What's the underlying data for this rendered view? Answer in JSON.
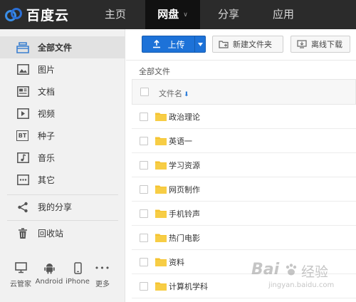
{
  "app": {
    "logo_text": "百度云"
  },
  "nav": [
    {
      "label": "主页"
    },
    {
      "label": "网盘",
      "caret": "∨"
    },
    {
      "label": "分享"
    },
    {
      "label": "应用"
    }
  ],
  "sidebar": {
    "items": [
      {
        "label": "全部文件",
        "icon": "all-files-icon"
      },
      {
        "label": "图片",
        "icon": "image-icon"
      },
      {
        "label": "文档",
        "icon": "document-icon"
      },
      {
        "label": "视频",
        "icon": "video-icon"
      },
      {
        "label": "种子",
        "icon": "torrent-icon",
        "icon_text": "BT"
      },
      {
        "label": "音乐",
        "icon": "music-icon"
      },
      {
        "label": "其它",
        "icon": "other-icon"
      },
      {
        "label": "我的分享",
        "icon": "share-icon"
      },
      {
        "label": "回收站",
        "icon": "trash-icon"
      }
    ],
    "devices": [
      {
        "label": "云管家",
        "icon": "desktop-icon"
      },
      {
        "label": "Android",
        "icon": "android-icon"
      },
      {
        "label": "iPhone",
        "icon": "iphone-icon"
      },
      {
        "label": "更多",
        "icon": "more-icon",
        "icon_text": "•••"
      }
    ]
  },
  "toolbar": {
    "upload_label": "上传",
    "new_folder_label": "新建文件夹",
    "offline_download_label": "离线下载"
  },
  "breadcrumb": "全部文件",
  "table": {
    "header_name": "文件名",
    "sort_indicator": "⬇",
    "rows": [
      {
        "name": "政治理论"
      },
      {
        "name": "英语一"
      },
      {
        "name": "学习资源"
      },
      {
        "name": "网页制作"
      },
      {
        "name": "手机铃声"
      },
      {
        "name": "热门电影"
      },
      {
        "name": "资料"
      },
      {
        "name": "计算机学科"
      }
    ]
  },
  "watermark": {
    "brand": "Bai",
    "cn_text": "经验",
    "url": "jingyan.baidu.com"
  },
  "colors": {
    "topbar": "#2b2b2b",
    "accent": "#1d72d8",
    "folder": "#f5c330"
  }
}
